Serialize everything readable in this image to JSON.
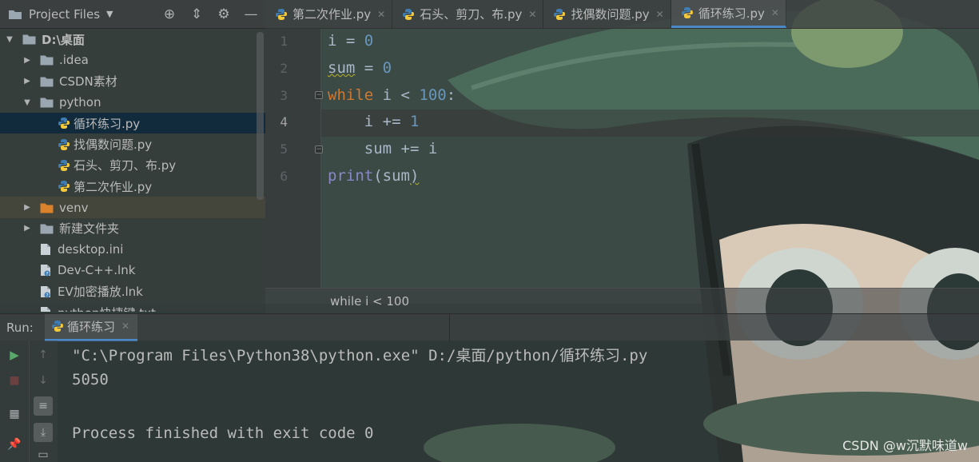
{
  "project_panel": {
    "title": "Project Files",
    "tree": [
      {
        "label": "D:\\桌面",
        "kind": "folder",
        "expanded": true,
        "depth": 0
      },
      {
        "label": ".idea",
        "kind": "folder",
        "expanded": false,
        "depth": 1
      },
      {
        "label": "CSDN素材",
        "kind": "folder",
        "expanded": false,
        "depth": 1
      },
      {
        "label": "python",
        "kind": "folder",
        "expanded": true,
        "depth": 1
      },
      {
        "label": "循环练习.py",
        "kind": "python",
        "depth": 2,
        "selected": true
      },
      {
        "label": "找偶数问题.py",
        "kind": "python",
        "depth": 2
      },
      {
        "label": "石头、剪刀、布.py",
        "kind": "python",
        "depth": 2
      },
      {
        "label": "第二次作业.py",
        "kind": "python",
        "depth": 2
      },
      {
        "label": "venv",
        "kind": "folder-orange",
        "expanded": false,
        "depth": 1
      },
      {
        "label": "新建文件夹",
        "kind": "folder",
        "expanded": false,
        "depth": 1
      },
      {
        "label": "desktop.ini",
        "kind": "file",
        "depth": 1
      },
      {
        "label": "Dev-C++.lnk",
        "kind": "link",
        "depth": 1
      },
      {
        "label": "EV加密播放.lnk",
        "kind": "link",
        "depth": 1
      },
      {
        "label": "python快捷键.txt",
        "kind": "file",
        "depth": 1
      }
    ]
  },
  "editor": {
    "tabs": [
      {
        "label": "第二次作业.py",
        "active": false
      },
      {
        "label": "石头、剪刀、布.py",
        "active": false
      },
      {
        "label": "找偶数问题.py",
        "active": false
      },
      {
        "label": "循环练习.py",
        "active": true
      }
    ],
    "line_numbers": [
      "1",
      "2",
      "3",
      "4",
      "5",
      "6"
    ],
    "current_line": 4,
    "code": [
      [
        {
          "t": "i = ",
          "c": ""
        },
        {
          "t": "0",
          "c": "num"
        }
      ],
      [
        {
          "t": "sum",
          "c": "squiggle"
        },
        {
          "t": " = ",
          "c": ""
        },
        {
          "t": "0",
          "c": "num"
        }
      ],
      [
        {
          "t": "while",
          "c": "kw"
        },
        {
          "t": " i < ",
          "c": ""
        },
        {
          "t": "100",
          "c": "num"
        },
        {
          "t": ":",
          "c": ""
        }
      ],
      [
        {
          "t": "    i += ",
          "c": ""
        },
        {
          "t": "1",
          "c": "num"
        }
      ],
      [
        {
          "t": "    sum += i",
          "c": ""
        }
      ],
      [
        {
          "t": "print",
          "c": "fn"
        },
        {
          "t": "(sum",
          "c": ""
        },
        {
          "t": ")",
          "c": "squiggle"
        }
      ]
    ],
    "breadcrumb": "while i < 100"
  },
  "run_panel": {
    "label": "Run:",
    "tab": "循环练习",
    "output": [
      "\"C:\\Program Files\\Python38\\python.exe\" D:/桌面/python/循环练习.py",
      "5050",
      "",
      "Process finished with exit code 0"
    ]
  },
  "watermark": "CSDN @w沉默味道w",
  "colors": {
    "keyword": "#cc7832",
    "number": "#6897bb",
    "builtin": "#8888c6",
    "text": "#a9b7c6",
    "accent": "#4a88c7",
    "run_green": "#59a869"
  }
}
